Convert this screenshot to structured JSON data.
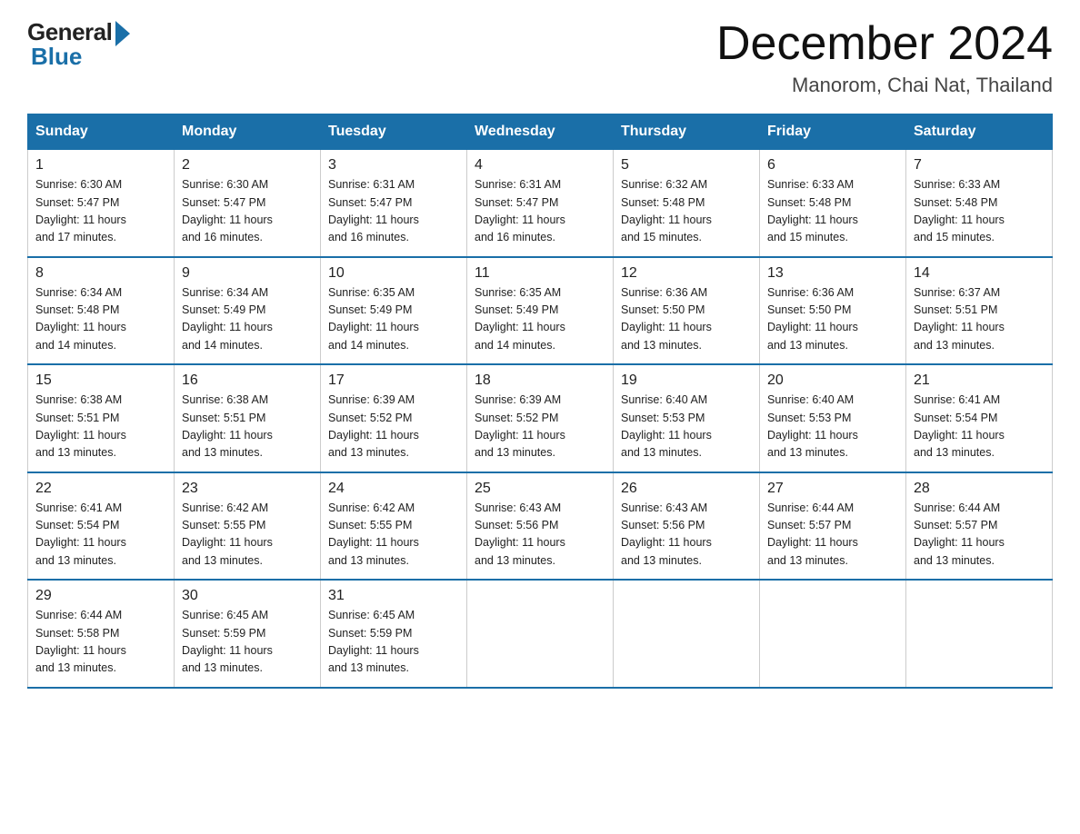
{
  "header": {
    "logo_general": "General",
    "logo_blue": "Blue",
    "month_title": "December 2024",
    "location": "Manorom, Chai Nat, Thailand"
  },
  "weekdays": [
    "Sunday",
    "Monday",
    "Tuesday",
    "Wednesday",
    "Thursday",
    "Friday",
    "Saturday"
  ],
  "weeks": [
    [
      {
        "day": "1",
        "sunrise": "6:30 AM",
        "sunset": "5:47 PM",
        "daylight": "11 hours and 17 minutes."
      },
      {
        "day": "2",
        "sunrise": "6:30 AM",
        "sunset": "5:47 PM",
        "daylight": "11 hours and 16 minutes."
      },
      {
        "day": "3",
        "sunrise": "6:31 AM",
        "sunset": "5:47 PM",
        "daylight": "11 hours and 16 minutes."
      },
      {
        "day": "4",
        "sunrise": "6:31 AM",
        "sunset": "5:47 PM",
        "daylight": "11 hours and 16 minutes."
      },
      {
        "day": "5",
        "sunrise": "6:32 AM",
        "sunset": "5:48 PM",
        "daylight": "11 hours and 15 minutes."
      },
      {
        "day": "6",
        "sunrise": "6:33 AM",
        "sunset": "5:48 PM",
        "daylight": "11 hours and 15 minutes."
      },
      {
        "day": "7",
        "sunrise": "6:33 AM",
        "sunset": "5:48 PM",
        "daylight": "11 hours and 15 minutes."
      }
    ],
    [
      {
        "day": "8",
        "sunrise": "6:34 AM",
        "sunset": "5:48 PM",
        "daylight": "11 hours and 14 minutes."
      },
      {
        "day": "9",
        "sunrise": "6:34 AM",
        "sunset": "5:49 PM",
        "daylight": "11 hours and 14 minutes."
      },
      {
        "day": "10",
        "sunrise": "6:35 AM",
        "sunset": "5:49 PM",
        "daylight": "11 hours and 14 minutes."
      },
      {
        "day": "11",
        "sunrise": "6:35 AM",
        "sunset": "5:49 PM",
        "daylight": "11 hours and 14 minutes."
      },
      {
        "day": "12",
        "sunrise": "6:36 AM",
        "sunset": "5:50 PM",
        "daylight": "11 hours and 13 minutes."
      },
      {
        "day": "13",
        "sunrise": "6:36 AM",
        "sunset": "5:50 PM",
        "daylight": "11 hours and 13 minutes."
      },
      {
        "day": "14",
        "sunrise": "6:37 AM",
        "sunset": "5:51 PM",
        "daylight": "11 hours and 13 minutes."
      }
    ],
    [
      {
        "day": "15",
        "sunrise": "6:38 AM",
        "sunset": "5:51 PM",
        "daylight": "11 hours and 13 minutes."
      },
      {
        "day": "16",
        "sunrise": "6:38 AM",
        "sunset": "5:51 PM",
        "daylight": "11 hours and 13 minutes."
      },
      {
        "day": "17",
        "sunrise": "6:39 AM",
        "sunset": "5:52 PM",
        "daylight": "11 hours and 13 minutes."
      },
      {
        "day": "18",
        "sunrise": "6:39 AM",
        "sunset": "5:52 PM",
        "daylight": "11 hours and 13 minutes."
      },
      {
        "day": "19",
        "sunrise": "6:40 AM",
        "sunset": "5:53 PM",
        "daylight": "11 hours and 13 minutes."
      },
      {
        "day": "20",
        "sunrise": "6:40 AM",
        "sunset": "5:53 PM",
        "daylight": "11 hours and 13 minutes."
      },
      {
        "day": "21",
        "sunrise": "6:41 AM",
        "sunset": "5:54 PM",
        "daylight": "11 hours and 13 minutes."
      }
    ],
    [
      {
        "day": "22",
        "sunrise": "6:41 AM",
        "sunset": "5:54 PM",
        "daylight": "11 hours and 13 minutes."
      },
      {
        "day": "23",
        "sunrise": "6:42 AM",
        "sunset": "5:55 PM",
        "daylight": "11 hours and 13 minutes."
      },
      {
        "day": "24",
        "sunrise": "6:42 AM",
        "sunset": "5:55 PM",
        "daylight": "11 hours and 13 minutes."
      },
      {
        "day": "25",
        "sunrise": "6:43 AM",
        "sunset": "5:56 PM",
        "daylight": "11 hours and 13 minutes."
      },
      {
        "day": "26",
        "sunrise": "6:43 AM",
        "sunset": "5:56 PM",
        "daylight": "11 hours and 13 minutes."
      },
      {
        "day": "27",
        "sunrise": "6:44 AM",
        "sunset": "5:57 PM",
        "daylight": "11 hours and 13 minutes."
      },
      {
        "day": "28",
        "sunrise": "6:44 AM",
        "sunset": "5:57 PM",
        "daylight": "11 hours and 13 minutes."
      }
    ],
    [
      {
        "day": "29",
        "sunrise": "6:44 AM",
        "sunset": "5:58 PM",
        "daylight": "11 hours and 13 minutes."
      },
      {
        "day": "30",
        "sunrise": "6:45 AM",
        "sunset": "5:59 PM",
        "daylight": "11 hours and 13 minutes."
      },
      {
        "day": "31",
        "sunrise": "6:45 AM",
        "sunset": "5:59 PM",
        "daylight": "11 hours and 13 minutes."
      },
      null,
      null,
      null,
      null
    ]
  ],
  "labels": {
    "sunrise": "Sunrise:",
    "sunset": "Sunset:",
    "daylight": "Daylight:"
  }
}
